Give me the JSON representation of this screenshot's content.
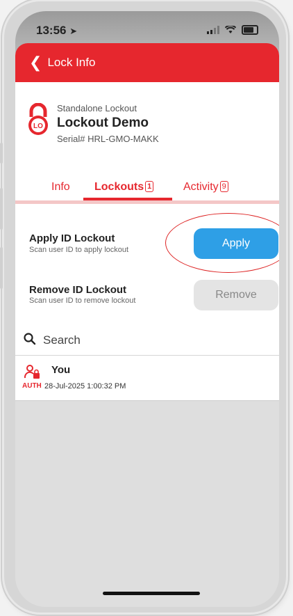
{
  "status": {
    "time": "13:56"
  },
  "header": {
    "title": "Lock Info"
  },
  "lock": {
    "type": "Standalone Lockout",
    "name": "Lockout Demo",
    "serial": "Serial# HRL-GMO-MAKK",
    "badge": "LO"
  },
  "tabs": [
    {
      "label": "Info"
    },
    {
      "label": "Lockouts",
      "count": "1"
    },
    {
      "label": "Activity",
      "count": "9"
    }
  ],
  "actions": {
    "apply": {
      "title": "Apply ID Lockout",
      "subtitle": "Scan user ID to apply lockout",
      "button": "Apply"
    },
    "remove": {
      "title": "Remove ID Lockout",
      "subtitle": "Scan user ID to remove lockout",
      "button": "Remove"
    }
  },
  "search": {
    "placeholder": "Search"
  },
  "lockouts": [
    {
      "name": "You",
      "date": "28-Jul-2025 1:00:32 PM",
      "tag": "AUTH"
    }
  ],
  "colors": {
    "brand": "#e6272e",
    "accent": "#2e9fe6"
  }
}
